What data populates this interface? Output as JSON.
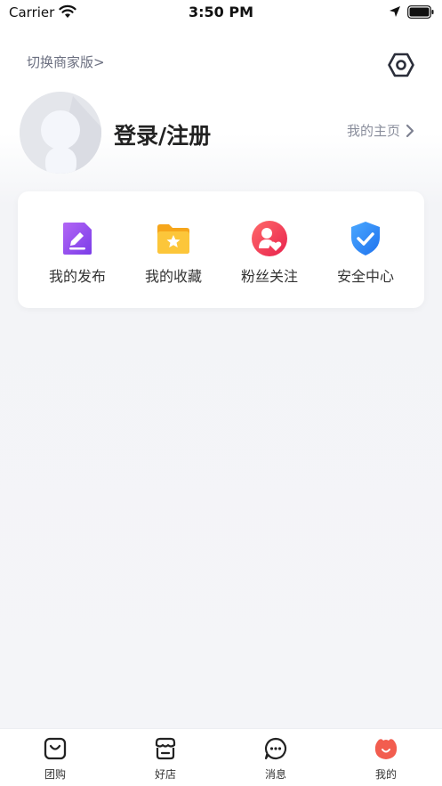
{
  "status_bar": {
    "carrier": "Carrier",
    "time": "3:50 PM"
  },
  "header": {
    "merchant_switch": "切换商家版>"
  },
  "profile": {
    "login_label": "登录/注册",
    "homepage_label": "我的主页"
  },
  "functions": [
    {
      "label": "我的发布",
      "icon": "edit-doc-icon",
      "color": "#8b4cf0"
    },
    {
      "label": "我的收藏",
      "icon": "star-folder-icon",
      "color": "#fbb81f"
    },
    {
      "label": "粉丝关注",
      "icon": "fans-heart-icon",
      "color": "#f2405a"
    },
    {
      "label": "安全中心",
      "icon": "shield-check-icon",
      "color": "#2f8ff5"
    }
  ],
  "tab_bar": {
    "tabs": [
      {
        "label": "团购",
        "icon": "shopping-bag-icon",
        "active": false
      },
      {
        "label": "好店",
        "icon": "shop-icon",
        "active": false
      },
      {
        "label": "消息",
        "icon": "chat-bubble-icon",
        "active": false
      },
      {
        "label": "我的",
        "icon": "profile-tab-icon",
        "active": true
      }
    ],
    "active_color": "#f25d4f"
  }
}
